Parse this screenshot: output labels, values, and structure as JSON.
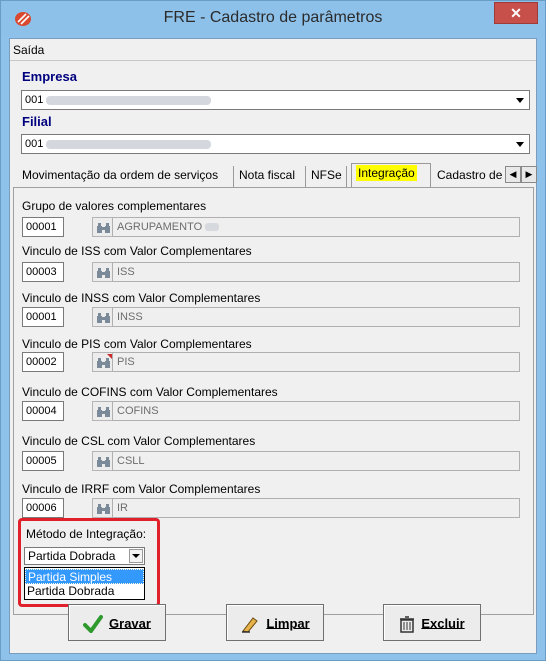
{
  "window": {
    "title": "FRE - Cadastro de parâmetros",
    "close_label": "✕"
  },
  "menu": {
    "exit_label": "Saída"
  },
  "empresa": {
    "label": "Empresa",
    "value": "001"
  },
  "filial": {
    "label": "Filial",
    "value": "001"
  },
  "tabs": [
    {
      "label": "Movimentação da ordem de serviços"
    },
    {
      "label": "Nota fiscal"
    },
    {
      "label": "NFSe"
    },
    {
      "label": "Integração"
    },
    {
      "label": "Cadastro de"
    }
  ],
  "fields": [
    {
      "label": "Grupo de valores complementares",
      "code": "00001",
      "desc": "AGRUPAMENTO"
    },
    {
      "label": "Vinculo de ISS com Valor Complementares",
      "code": "00003",
      "desc": "ISS"
    },
    {
      "label": "Vinculo de INSS com Valor Complementares",
      "code": "00001",
      "desc": "INSS"
    },
    {
      "label": "Vinculo de PIS com Valor Complementares",
      "code": "00002",
      "desc": "PIS"
    },
    {
      "label": "Vinculo de COFINS com Valor Complementares",
      "code": "00004",
      "desc": "COFINS"
    },
    {
      "label": "Vinculo de CSL com Valor Complementares",
      "code": "00005",
      "desc": "CSLL"
    },
    {
      "label": "Vinculo de IRRF com Valor Complementares",
      "code": "00006",
      "desc": "IR"
    }
  ],
  "method": {
    "label": "Método de Integração:",
    "selected": "Partida Dobrada",
    "options": [
      "Partida Simples",
      "Partida Dobrada"
    ]
  },
  "buttons": {
    "save": "Gravar",
    "clear": "Limpar",
    "delete": "Excluir"
  },
  "colors": {
    "title_bar": "#8ec1ea",
    "close_button": "#c7504a",
    "active_tab_highlight": "#ffff00",
    "highlight_border": "#e0202a",
    "dropdown_selection": "#3399ff"
  }
}
